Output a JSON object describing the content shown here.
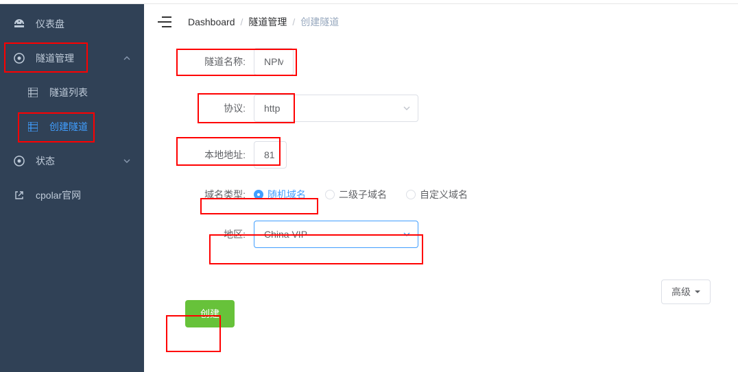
{
  "sidebar": {
    "items": [
      {
        "icon": "dashboard-icon",
        "label": "仪表盘"
      },
      {
        "icon": "target-icon",
        "label": "隧道管理",
        "expandable": true,
        "expanded": true
      },
      {
        "icon": "table-icon",
        "label": "隧道列表",
        "sub": true
      },
      {
        "icon": "table-icon",
        "label": "创建隧道",
        "sub": true,
        "active": true
      },
      {
        "icon": "target-icon",
        "label": "状态",
        "expandable": true
      },
      {
        "icon": "external-link-icon",
        "label": "cpolar官网"
      }
    ]
  },
  "breadcrumb": {
    "items": [
      "Dashboard",
      "隧道管理",
      "创建隧道"
    ]
  },
  "form": {
    "tunnel_name": {
      "label": "隧道名称:",
      "value": "NPM"
    },
    "protocol": {
      "label": "协议:",
      "value": "http"
    },
    "local_addr": {
      "label": "本地地址:",
      "value": "81"
    },
    "domain_type": {
      "label": "域名类型:",
      "options": [
        "随机域名",
        "二级子域名",
        "自定义域名"
      ],
      "selected_index": 0
    },
    "region": {
      "label": "地区:",
      "value": "China VIP"
    },
    "advanced_label": "高级",
    "submit_label": "创建"
  }
}
